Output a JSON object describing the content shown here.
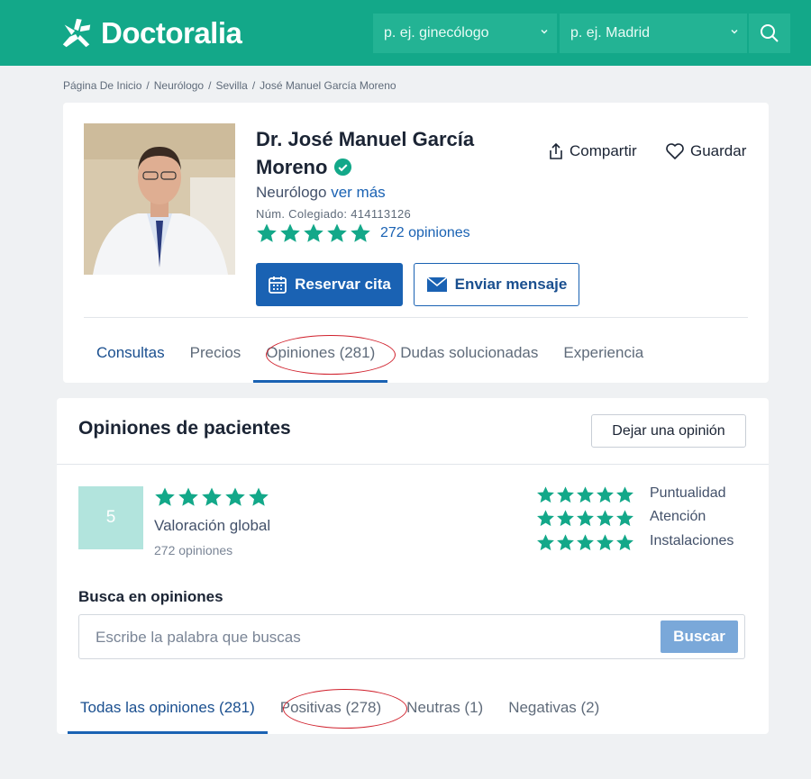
{
  "brand": {
    "name": "Doctoralia",
    "color": "#13a889"
  },
  "header": {
    "specialty_placeholder": "p. ej. ginecólogo",
    "location_placeholder": "p. ej. Madrid"
  },
  "breadcrumb": [
    "Página De Inicio",
    "/",
    "Neurólogo",
    "/",
    "Sevilla",
    "/",
    "José Manuel García Moreno"
  ],
  "profile": {
    "name": "Dr. José Manuel García Moreno",
    "specialty": "Neurólogo",
    "more_link": "ver más",
    "colegiado": "Núm. Colegiado: 414113126",
    "rating_stars": 5,
    "opinions_link": "272 opiniones",
    "share_label": "Compartir",
    "save_label": "Guardar",
    "book_label": "Reservar cita",
    "message_label": "Enviar mensaje",
    "tabs": [
      "Consultas",
      "Precios",
      "Opiniones (281)",
      "Dudas solucionadas",
      "Experiencia"
    ]
  },
  "opinions": {
    "title": "Opiniones de pacientes",
    "leave_label": "Dejar una opinión",
    "score": "5",
    "global_label": "Valoración global",
    "global_count": "272 opiniones",
    "criteria": [
      "Puntualidad",
      "Atención",
      "Instalaciones"
    ],
    "search_title": "Busca en opiniones",
    "search_placeholder": "Escribe la palabra que buscas",
    "search_button": "Buscar",
    "filters": [
      "Todas las opiniones (281)",
      "Positivas (278)",
      "Neutras (1)",
      "Negativas (2)"
    ]
  },
  "colors": {
    "accent": "#1a62b3",
    "star": "#13a889",
    "annotation": "#d0202c"
  }
}
